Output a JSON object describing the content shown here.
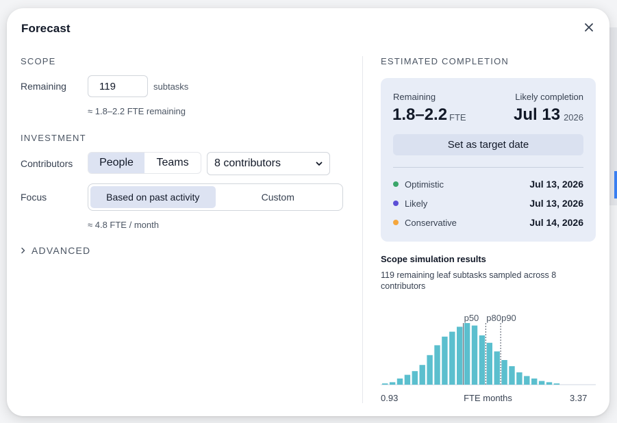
{
  "modal": {
    "title": "Forecast",
    "close_icon": "close-icon"
  },
  "scope": {
    "heading": "SCOPE",
    "remaining_label": "Remaining",
    "remaining_value": "119",
    "remaining_suffix": "subtasks",
    "fte_hint": "≈ 1.8–2.2 FTE remaining"
  },
  "investment": {
    "heading": "INVESTMENT",
    "contributors_label": "Contributors",
    "toggle": {
      "people": "People",
      "teams": "Teams",
      "selected": "People"
    },
    "contributors_select": "8 contributors",
    "focus_label": "Focus",
    "focus_options": {
      "past": "Based on past activity",
      "custom": "Custom",
      "selected": "Based on past activity"
    },
    "focus_hint": "≈ 4.8 FTE / month"
  },
  "advanced": {
    "label": "ADVANCED"
  },
  "estimate": {
    "heading": "ESTIMATED COMPLETION",
    "remaining_label": "Remaining",
    "remaining_value": "1.8–2.2",
    "remaining_unit": "FTE",
    "likely_label": "Likely completion",
    "likely_date": "Jul 13",
    "likely_year": "2026",
    "target_button": "Set as target date",
    "scenarios": [
      {
        "name": "Optimistic",
        "date": "Jul 13, 2026",
        "color": "#3aa66a"
      },
      {
        "name": "Likely",
        "date": "Jul 13, 2026",
        "color": "#5b4fd6"
      },
      {
        "name": "Conservative",
        "date": "Jul 14, 2026",
        "color": "#f5a63c"
      }
    ]
  },
  "simulation": {
    "title": "Scope simulation results",
    "description": "119 remaining leaf subtasks sampled across 8 contributors"
  },
  "chart_data": {
    "type": "bar",
    "title": "",
    "x_min_label": "0.93",
    "x_max_label": "3.37",
    "xlabel": "FTE months",
    "ylabel": "",
    "x_range": [
      0.93,
      3.37
    ],
    "values": [
      1,
      2,
      5,
      8,
      11,
      16,
      24,
      32,
      39,
      43,
      47,
      50,
      48,
      40,
      34,
      27,
      20,
      15,
      10,
      7,
      5,
      3,
      2,
      1,
      0
    ],
    "markers": [
      {
        "label": "p50",
        "bin": 10
      },
      {
        "label": "p80",
        "bin": 13
      },
      {
        "label": "p90",
        "bin": 15
      }
    ],
    "bar_color": "#5bbfce",
    "grid": false
  }
}
